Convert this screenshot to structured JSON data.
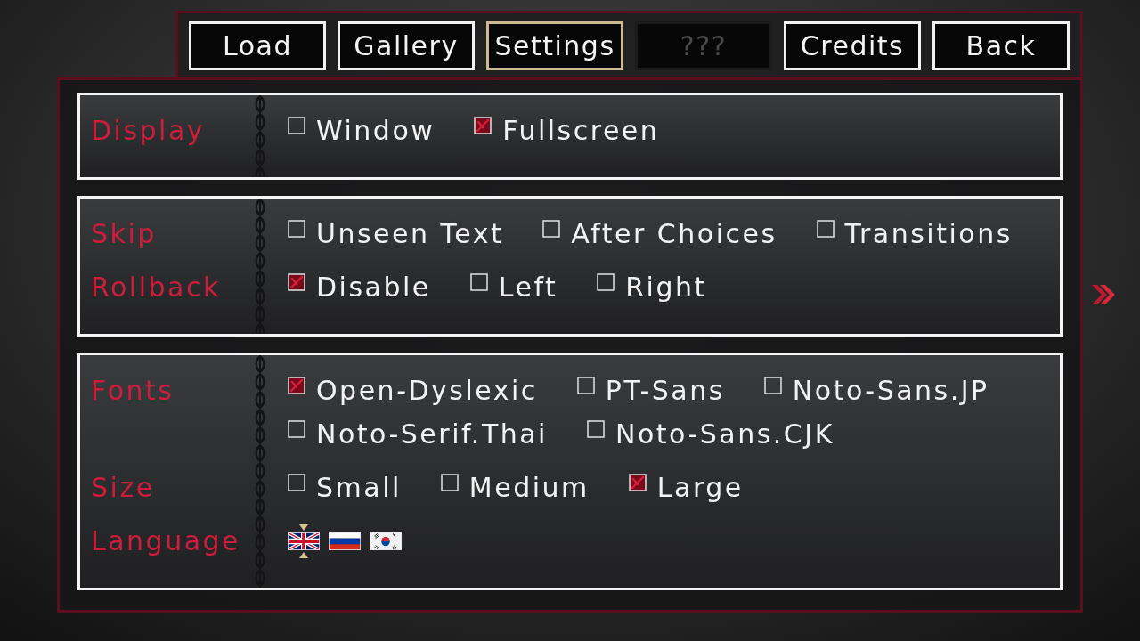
{
  "menu": [
    {
      "label": "Load",
      "selected": false,
      "disabled": false
    },
    {
      "label": "Gallery",
      "selected": false,
      "disabled": false
    },
    {
      "label": "Settings",
      "selected": true,
      "disabled": false
    },
    {
      "label": "???",
      "selected": false,
      "disabled": true
    },
    {
      "label": "Credits",
      "selected": false,
      "disabled": false
    },
    {
      "label": "Back",
      "selected": false,
      "disabled": false
    }
  ],
  "sections": [
    {
      "rows": [
        {
          "kind": "checkboxes",
          "label": "Display",
          "options": [
            {
              "label": "Window",
              "checked": false
            },
            {
              "label": "Fullscreen",
              "checked": true
            }
          ]
        }
      ]
    },
    {
      "rows": [
        {
          "kind": "checkboxes",
          "label": "Skip",
          "options": [
            {
              "label": "Unseen Text",
              "checked": false
            },
            {
              "label": "After Choices",
              "checked": false
            },
            {
              "label": "Transitions",
              "checked": false
            }
          ]
        },
        {
          "kind": "checkboxes",
          "label": "Rollback",
          "options": [
            {
              "label": "Disable",
              "checked": true
            },
            {
              "label": "Left",
              "checked": false
            },
            {
              "label": "Right",
              "checked": false
            }
          ]
        }
      ]
    },
    {
      "rows": [
        {
          "kind": "checkboxes",
          "label": "Fonts",
          "options": [
            {
              "label": "Open-Dyslexic",
              "checked": true
            },
            {
              "label": "PT-Sans",
              "checked": false
            },
            {
              "label": "Noto-Sans.JP",
              "checked": false
            },
            {
              "label": "Noto-Serif.Thai",
              "checked": false
            },
            {
              "label": "Noto-Sans.CJK",
              "checked": false
            }
          ]
        },
        {
          "kind": "checkboxes",
          "label": "Size",
          "options": [
            {
              "label": "Small",
              "checked": false
            },
            {
              "label": "Medium",
              "checked": false
            },
            {
              "label": "Large",
              "checked": true
            }
          ]
        },
        {
          "kind": "flags",
          "label": "Language",
          "flags": [
            {
              "kind": "uk",
              "selected": true
            },
            {
              "kind": "ru",
              "selected": false
            },
            {
              "kind": "kr",
              "selected": false
            }
          ]
        }
      ]
    }
  ]
}
